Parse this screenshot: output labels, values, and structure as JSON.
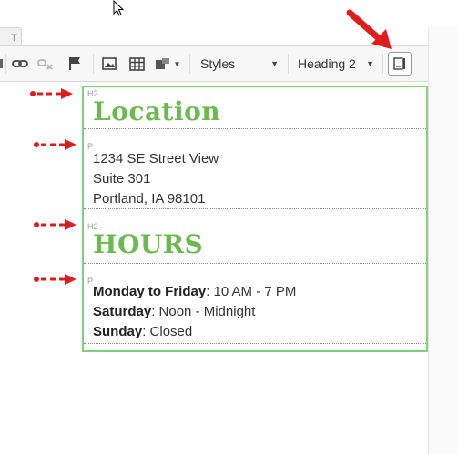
{
  "tab": {
    "label": "T"
  },
  "toolbar": {
    "styles_label": "Styles",
    "format_label": "Heading 2",
    "icons": [
      "link-icon",
      "unlink-icon",
      "flag-icon",
      "image-icon",
      "table-icon",
      "layout-icon",
      "source-mode-icon"
    ]
  },
  "editor": {
    "blocks": [
      {
        "tag": "H2",
        "text": "Location"
      },
      {
        "tag": "P",
        "lines": [
          "1234 SE Street View",
          "Suite 301",
          "Portland, IA 98101"
        ]
      },
      {
        "tag": "H2",
        "text": "HOURS"
      },
      {
        "tag": "P",
        "hours": [
          {
            "day": "Monday to Friday",
            "time": ": 10 AM - 7 PM"
          },
          {
            "day": "Saturday",
            "time": ": Noon - Midnight"
          },
          {
            "day": "Sunday",
            "time": ": Closed"
          }
        ]
      }
    ]
  },
  "colors": {
    "heading": "#6aba4d",
    "outline": "#7fd27a",
    "annotation": "#e01b1b"
  }
}
